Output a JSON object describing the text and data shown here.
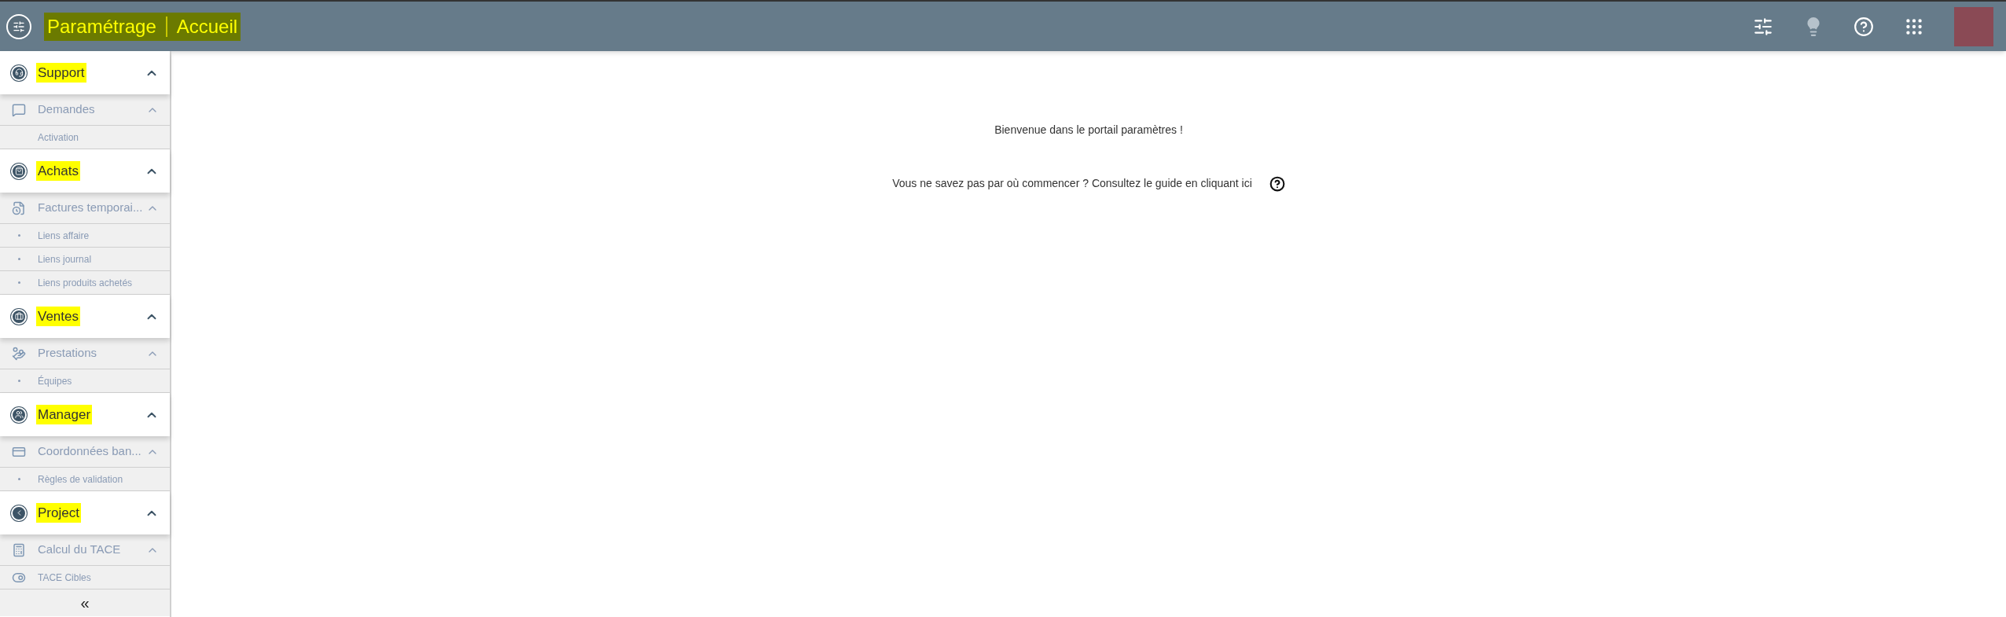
{
  "header": {
    "title": "Paramétrage",
    "subtitle": "Accueil",
    "highlighted": true
  },
  "sidebar": {
    "sections": [
      {
        "label": "Support",
        "highlighted": true,
        "expanded": true,
        "groups": [
          {
            "label": "Demandes",
            "expanded": true,
            "items": [
              {
                "label": "Activation",
                "kind": "plain"
              }
            ]
          }
        ]
      },
      {
        "label": "Achats",
        "highlighted": true,
        "expanded": true,
        "groups": [
          {
            "label": "Factures temporai...",
            "expanded": true,
            "items": [
              {
                "label": "Liens affaire",
                "kind": "bullet"
              },
              {
                "label": "Liens journal",
                "kind": "bullet"
              },
              {
                "label": "Liens produits achetés",
                "kind": "bullet"
              }
            ]
          }
        ]
      },
      {
        "label": "Ventes",
        "highlighted": true,
        "expanded": true,
        "groups": [
          {
            "label": "Prestations",
            "expanded": true,
            "items": [
              {
                "label": "Équipes",
                "kind": "bullet"
              }
            ]
          }
        ]
      },
      {
        "label": "Manager",
        "highlighted": true,
        "expanded": true,
        "groups": [
          {
            "label": "Coordonnées ban...",
            "expanded": true,
            "items": [
              {
                "label": "Règles de validation",
                "kind": "bullet"
              }
            ]
          }
        ]
      },
      {
        "label": "Project",
        "highlighted": true,
        "expanded": true,
        "groups": [
          {
            "label": "Calcul du TACE",
            "expanded": true,
            "items": [
              {
                "label": "TACE Cibles",
                "kind": "toggle"
              }
            ]
          }
        ]
      }
    ],
    "collapse": "«"
  },
  "main": {
    "welcome": "Bienvenue dans le portail paramètres !",
    "guide": "Vous ne savez pas par où commencer ? Consultez le guide en cliquant ici"
  }
}
